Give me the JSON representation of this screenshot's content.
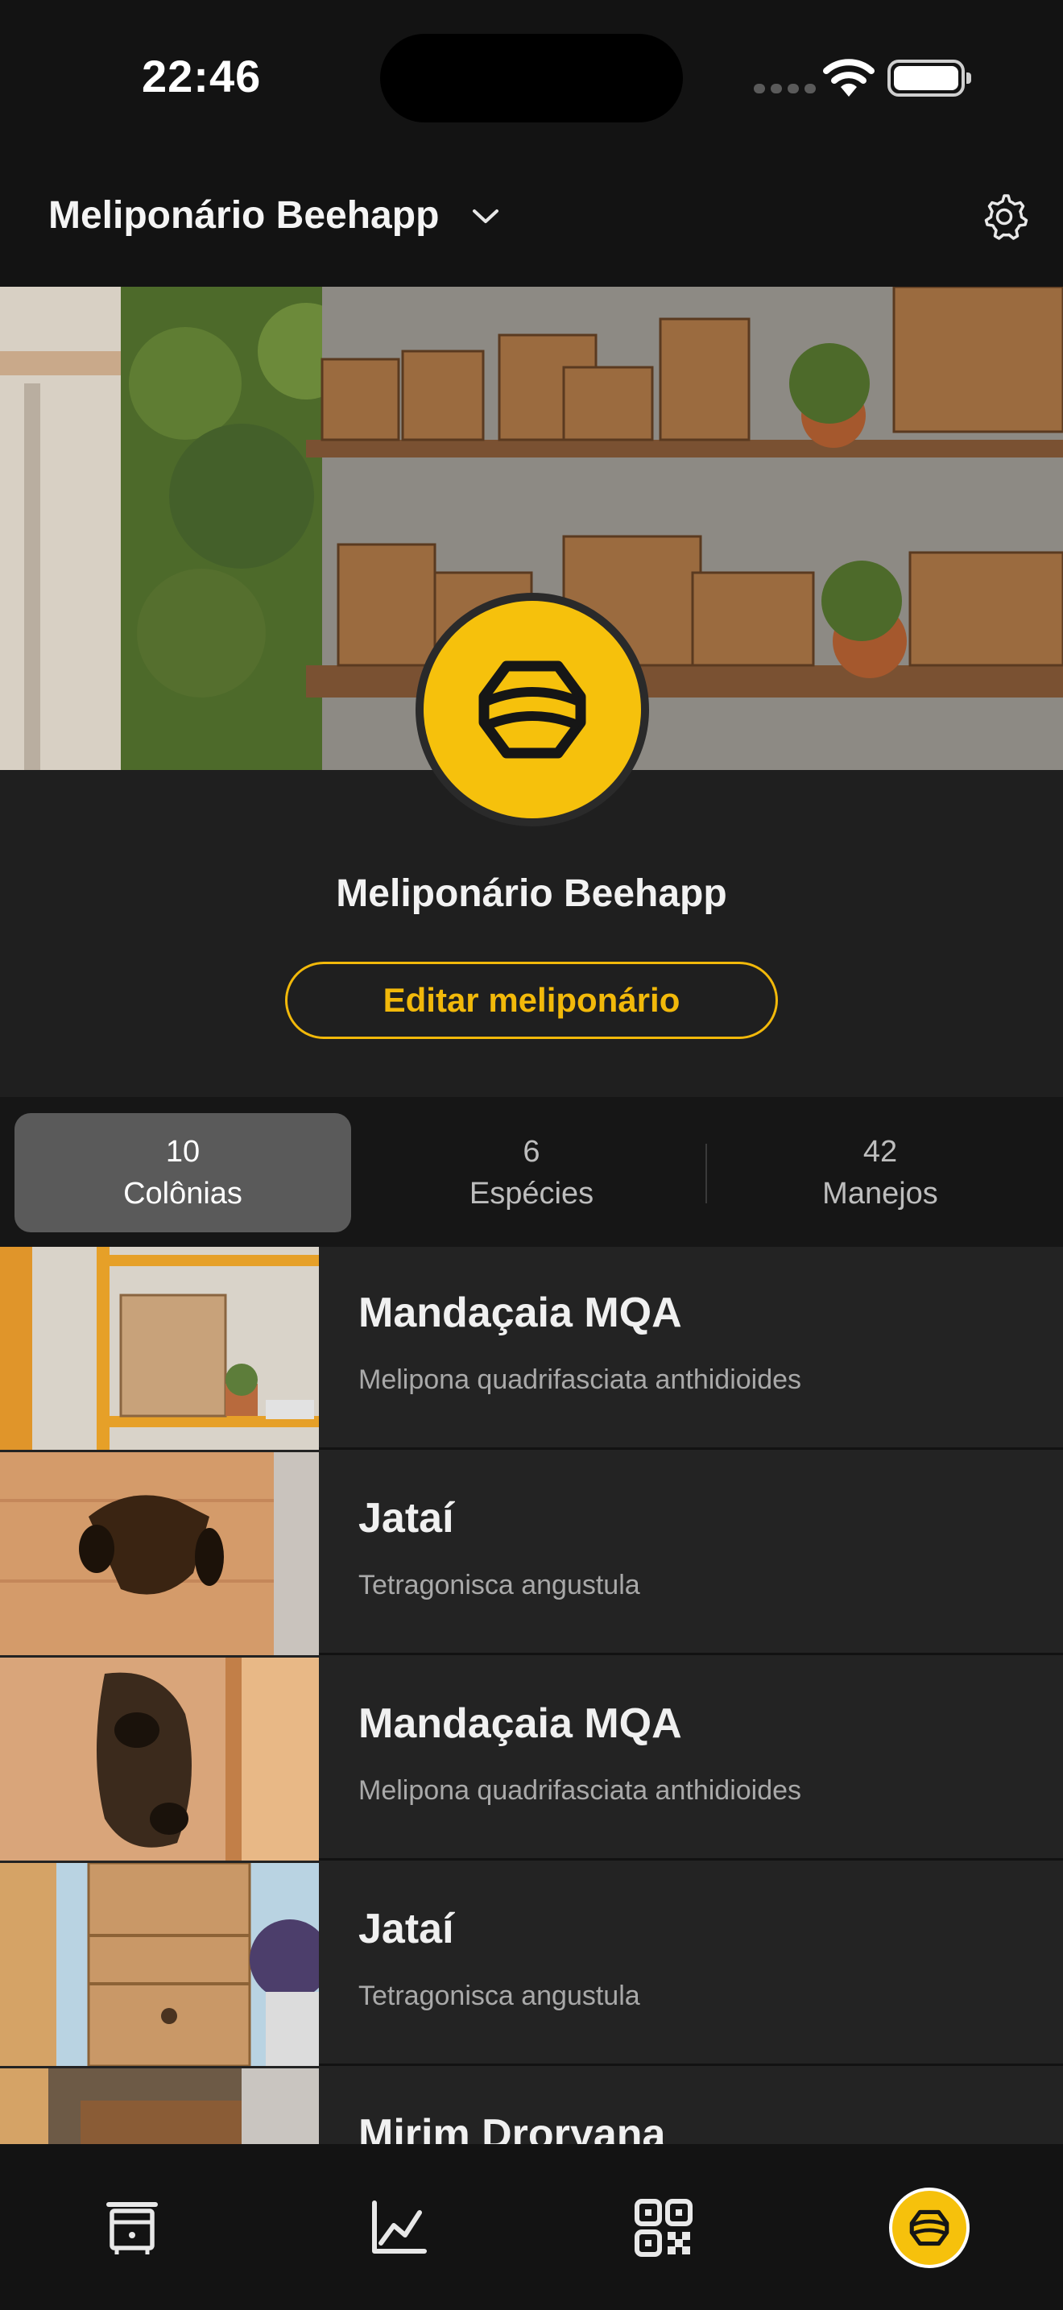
{
  "status_bar": {
    "time": "22:46"
  },
  "header": {
    "title": "Meliponário Beehapp",
    "dropdown_icon": "chevron-down-icon",
    "settings_icon": "gear-icon"
  },
  "profile": {
    "name": "Meliponário Beehapp",
    "edit_label": "Editar meliponário",
    "logo_icon": "beehive-logo-icon",
    "accent_color": "#f6c10c"
  },
  "stats": [
    {
      "count": "10",
      "label": "Colônias",
      "active": true
    },
    {
      "count": "6",
      "label": "Espécies",
      "active": false
    },
    {
      "count": "42",
      "label": "Manejos",
      "active": false
    }
  ],
  "colonies": [
    {
      "name": "Mandaçaia MQA",
      "species": "Melipona quadrifasciata anthidioides"
    },
    {
      "name": "Jataí",
      "species": "Tetragonisca angustula"
    },
    {
      "name": "Mandaçaia MQA",
      "species": "Melipona quadrifasciata anthidioides"
    },
    {
      "name": "Jataí",
      "species": "Tetragonisca angustula"
    },
    {
      "name": "Mirim Droryana",
      "species": ""
    }
  ],
  "bottom_nav": [
    {
      "name": "hive-box-icon"
    },
    {
      "name": "chart-icon"
    },
    {
      "name": "qr-code-icon"
    },
    {
      "name": "meliponary-logo-icon",
      "active": true
    }
  ]
}
